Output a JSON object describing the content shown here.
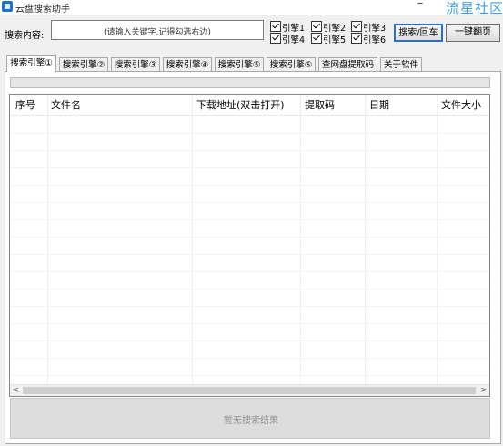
{
  "window": {
    "title": "云盘搜索助手",
    "minimize": "–",
    "watermark": "流星社区"
  },
  "search": {
    "label": "搜索内容:",
    "placeholder": "(请输入关键字,记得勾选右边)"
  },
  "engines": [
    {
      "label": "引擎1",
      "checked": true
    },
    {
      "label": "引擎2",
      "checked": true
    },
    {
      "label": "引擎3",
      "checked": true
    },
    {
      "label": "引擎4",
      "checked": true
    },
    {
      "label": "引擎5",
      "checked": true
    },
    {
      "label": "引擎6",
      "checked": true
    }
  ],
  "buttons": {
    "search": "搜索/回车",
    "one_key": "一键翻页"
  },
  "tabs": [
    {
      "label": "搜索引擎①",
      "active": true
    },
    {
      "label": "搜索引擎②"
    },
    {
      "label": "搜索引擎③"
    },
    {
      "label": "搜索引擎④"
    },
    {
      "label": "搜索引擎⑤"
    },
    {
      "label": "搜索引擎⑥"
    },
    {
      "label": "查网盘提取码"
    },
    {
      "label": "关于软件"
    }
  ],
  "progress": 0,
  "table": {
    "columns": [
      "序号",
      "文件名",
      "下载地址(双击打开)",
      "提取码",
      "日期",
      "文件大小"
    ],
    "rows": []
  },
  "scrollbar": {
    "left_arrow": "<",
    "right_arrow": ">"
  },
  "status": "暂无搜索结果",
  "colors": {
    "accent": "#2e6fc3",
    "watermark": "#4a9fe0"
  }
}
